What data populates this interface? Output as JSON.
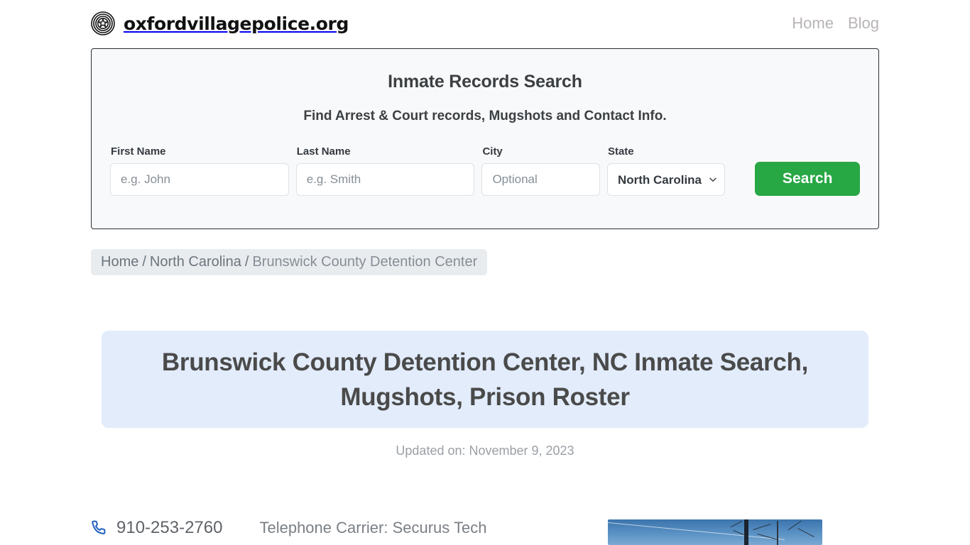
{
  "header": {
    "logo_icon": "police-badge-icon",
    "brand": "oxfordvillagepolice.org",
    "nav": [
      {
        "label": "Home"
      },
      {
        "label": "Blog"
      }
    ]
  },
  "search_panel": {
    "title": "Inmate Records Search",
    "subtitle": "Find Arrest & Court records, Mugshots and Contact Info.",
    "fields": [
      {
        "label": "First Name",
        "placeholder": "e.g. John",
        "value": ""
      },
      {
        "label": "Last Name",
        "placeholder": "e.g. Smith",
        "value": ""
      },
      {
        "label": "City",
        "placeholder": "Optional",
        "value": ""
      }
    ],
    "state": {
      "label": "State",
      "selected": "North Carolina",
      "chevron_icon": "chevron-down-icon"
    },
    "search_button": "Search",
    "accent_color": "#28a745"
  },
  "breadcrumb": {
    "items": [
      {
        "label": "Home"
      },
      {
        "label": "North Carolina"
      },
      {
        "label": "Brunswick County Detention Center"
      }
    ],
    "separator": "/"
  },
  "title_block": {
    "heading": "Brunswick County Detention Center, NC Inmate Search, Mugshots, Prison Roster",
    "panel_color": "#e2ecfb",
    "updated": "Updated on: November 9, 2023"
  },
  "facility_info": {
    "phone_icon": "phone-icon",
    "phone": "910-253-2760",
    "carrier": "Telephone Carrier: Securus Tech",
    "photo_alt": "facility-photo"
  }
}
